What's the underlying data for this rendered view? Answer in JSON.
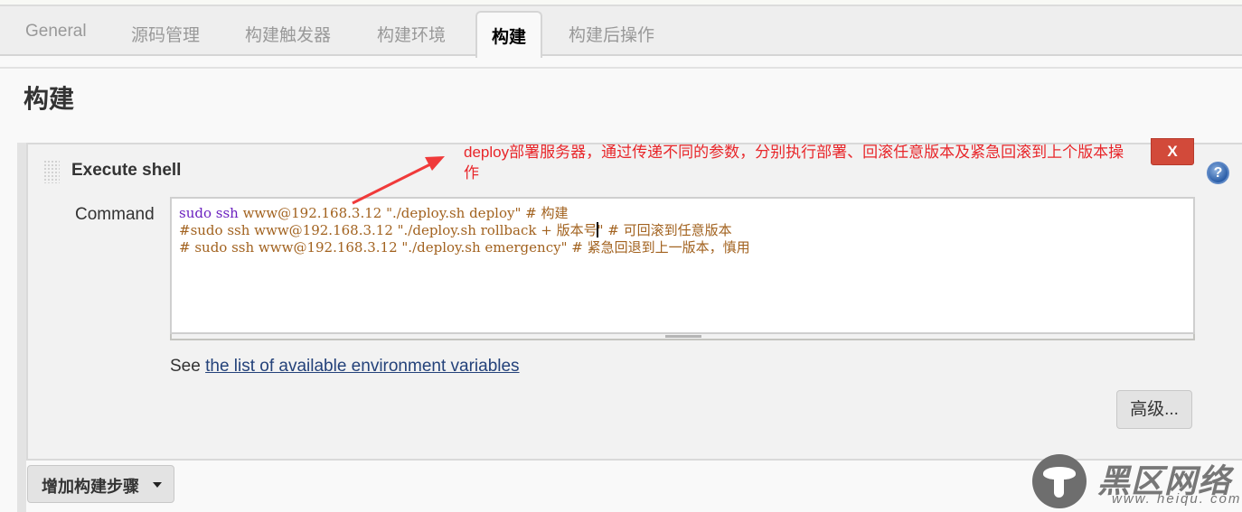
{
  "tabs": [
    {
      "label": "General",
      "active": false
    },
    {
      "label": "源码管理",
      "active": false
    },
    {
      "label": "构建触发器",
      "active": false
    },
    {
      "label": "构建环境",
      "active": false
    },
    {
      "label": "构建",
      "active": true
    },
    {
      "label": "构建后操作",
      "active": false
    }
  ],
  "section": {
    "title": "构建"
  },
  "build_step": {
    "title": "Execute shell",
    "delete_label": "X",
    "help_icon": "?",
    "command_label": "Command",
    "command_lines": [
      {
        "keyword": "sudo ssh",
        "rest": " www@192.168.3.12 \"./deploy.sh deploy\" # 构建"
      },
      {
        "keyword": "",
        "rest": "#sudo ssh www@192.168.3.12 \"./deploy.sh rollback + 版本号",
        "after_caret": "\" # 可回滚到任意版本"
      },
      {
        "keyword": "",
        "rest": "# sudo ssh www@192.168.3.12 \"./deploy.sh emergency\" # 紧急回退到上一版本，慎用"
      }
    ],
    "see_prefix": "See",
    "env_vars_link": "the list of available environment variables",
    "advanced_label": "高级..."
  },
  "annotation": {
    "text": "deploy部署服务器，通过传递不同的参数，分别执行部署、回滚任意版本及紧急回滚到上个版本操作",
    "color": "#e8262a"
  },
  "add_step_label": "增加构建步骤",
  "watermark": {
    "name": "黑区网络",
    "url": "www. heiqu. com"
  }
}
